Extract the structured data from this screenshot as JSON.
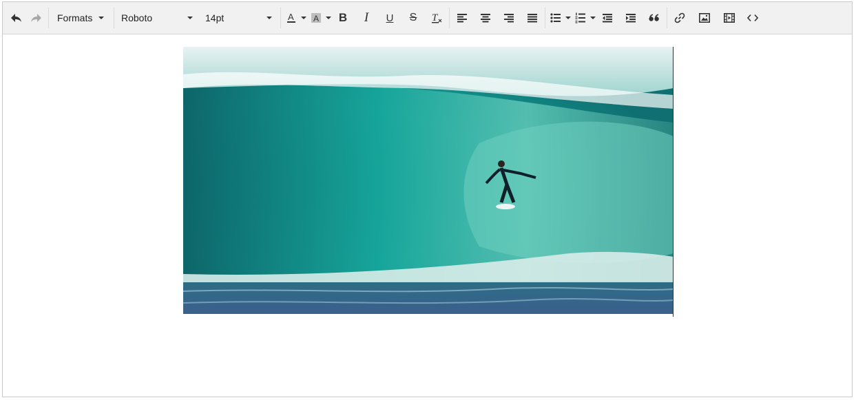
{
  "toolbar": {
    "formats_label": "Formats",
    "font_family": "Roboto",
    "font_size": "14pt",
    "buttons": {
      "undo": "undo",
      "redo": "redo",
      "bold": "B",
      "italic": "I",
      "underline": "U",
      "strikethrough": "S",
      "clear_format": "T",
      "text_color": "A",
      "background_color": "A"
    }
  },
  "content": {
    "image_alt": "Surfer riding inside a turquoise barrel wave"
  },
  "colors": {
    "toolbar_bg": "#f1f1f1",
    "border": "#c9c9c9",
    "icon": "#333333"
  }
}
